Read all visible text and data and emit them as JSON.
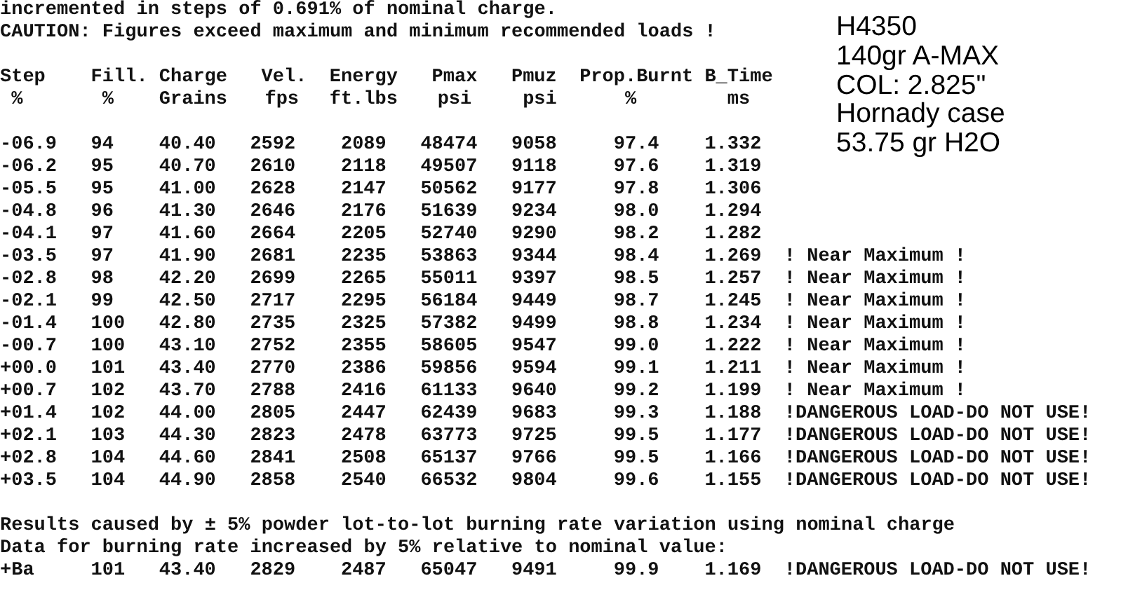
{
  "intro_lines": [
    "incremented in steps of 0.691% of nominal charge.",
    "CAUTION: Figures exceed maximum and minimum recommended loads !"
  ],
  "table": {
    "columns": [
      {
        "name": "Step",
        "unit": "%"
      },
      {
        "name": "Fill.",
        "unit": "%"
      },
      {
        "name": "Charge",
        "unit": "Grains"
      },
      {
        "name": "Vel.",
        "unit": "fps"
      },
      {
        "name": "Energy",
        "unit": "ft.lbs"
      },
      {
        "name": "Pmax",
        "unit": "psi"
      },
      {
        "name": "Pmuz",
        "unit": "psi"
      },
      {
        "name": "Prop.Burnt",
        "unit": "%"
      },
      {
        "name": "B_Time",
        "unit": "ms"
      }
    ],
    "rows": [
      {
        "cells": [
          "-06.9",
          "94",
          "40.40",
          "2592",
          "2089",
          "48474",
          "9058",
          "97.4",
          "1.332"
        ]
      },
      {
        "cells": [
          "-06.2",
          "95",
          "40.70",
          "2610",
          "2118",
          "49507",
          "9118",
          "97.6",
          "1.319"
        ]
      },
      {
        "cells": [
          "-05.5",
          "95",
          "41.00",
          "2628",
          "2147",
          "50562",
          "9177",
          "97.8",
          "1.306"
        ]
      },
      {
        "cells": [
          "-04.8",
          "96",
          "41.30",
          "2646",
          "2176",
          "51639",
          "9234",
          "98.0",
          "1.294"
        ]
      },
      {
        "cells": [
          "-04.1",
          "97",
          "41.60",
          "2664",
          "2205",
          "52740",
          "9290",
          "98.2",
          "1.282"
        ]
      },
      {
        "cells": [
          "-03.5",
          "97",
          "41.90",
          "2681",
          "2235",
          "53863",
          "9344",
          "98.4",
          "1.269"
        ],
        "warning": "! Near Maximum !"
      },
      {
        "cells": [
          "-02.8",
          "98",
          "42.20",
          "2699",
          "2265",
          "55011",
          "9397",
          "98.5",
          "1.257"
        ],
        "warning": "! Near Maximum !"
      },
      {
        "cells": [
          "-02.1",
          "99",
          "42.50",
          "2717",
          "2295",
          "56184",
          "9449",
          "98.7",
          "1.245"
        ],
        "warning": "! Near Maximum !"
      },
      {
        "cells": [
          "-01.4",
          "100",
          "42.80",
          "2735",
          "2325",
          "57382",
          "9499",
          "98.8",
          "1.234"
        ],
        "warning": "! Near Maximum !"
      },
      {
        "cells": [
          "-00.7",
          "100",
          "43.10",
          "2752",
          "2355",
          "58605",
          "9547",
          "99.0",
          "1.222"
        ],
        "warning": "! Near Maximum !"
      },
      {
        "cells": [
          "+00.0",
          "101",
          "43.40",
          "2770",
          "2386",
          "59856",
          "9594",
          "99.1",
          "1.211"
        ],
        "warning": "! Near Maximum !"
      },
      {
        "cells": [
          "+00.7",
          "102",
          "43.70",
          "2788",
          "2416",
          "61133",
          "9640",
          "99.2",
          "1.199"
        ],
        "warning": "! Near Maximum !"
      },
      {
        "cells": [
          "+01.4",
          "102",
          "44.00",
          "2805",
          "2447",
          "62439",
          "9683",
          "99.3",
          "1.188"
        ],
        "warning": "!DANGEROUS LOAD-DO NOT USE!"
      },
      {
        "cells": [
          "+02.1",
          "103",
          "44.30",
          "2823",
          "2478",
          "63773",
          "9725",
          "99.5",
          "1.177"
        ],
        "warning": "!DANGEROUS LOAD-DO NOT USE!"
      },
      {
        "cells": [
          "+02.8",
          "104",
          "44.60",
          "2841",
          "2508",
          "65137",
          "9766",
          "99.5",
          "1.166"
        ],
        "warning": "!DANGEROUS LOAD-DO NOT USE!"
      },
      {
        "cells": [
          "+03.5",
          "104",
          "44.90",
          "2858",
          "2540",
          "66532",
          "9804",
          "99.6",
          "1.155"
        ],
        "warning": "!DANGEROUS LOAD-DO NOT USE!"
      }
    ]
  },
  "footer_lines": [
    "Results caused by ± 5% powder lot-to-lot burning rate variation using nominal charge",
    "Data for burning rate increased by 5% relative to nominal value:"
  ],
  "variation_rows": [
    {
      "cells": [
        "+Ba",
        "101",
        "43.40",
        "2829",
        "2487",
        "65047",
        "9491",
        "99.9",
        "1.169"
      ],
      "warning": "!DANGEROUS LOAD-DO NOT USE!"
    }
  ],
  "notes": [
    "H4350",
    "140gr A-MAX",
    "COL: 2.825\"",
    "Hornady case",
    "53.75 gr H2O"
  ]
}
